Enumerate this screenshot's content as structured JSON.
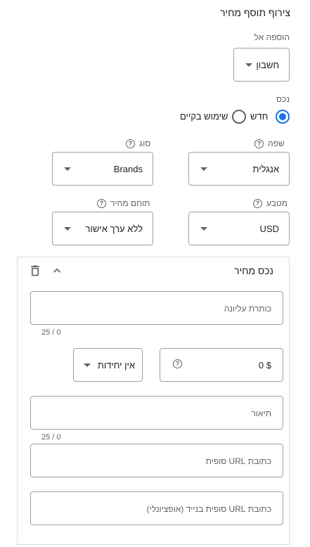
{
  "title": "צירוף תוסף מחיר",
  "add_to": {
    "label": "הוספה אל",
    "value": "חשבון"
  },
  "asset": {
    "label": "נכס",
    "options": [
      {
        "label": "חדש",
        "selected": true
      },
      {
        "label": "שימוש בקיים",
        "selected": false
      }
    ]
  },
  "language": {
    "label": "שפה",
    "value": "אנגלית"
  },
  "type": {
    "label": "סוג",
    "value": "Brands"
  },
  "currency": {
    "label": "מטבע",
    "value": "USD"
  },
  "price_range": {
    "label": "תוחם מחיר",
    "value": "ללא ערך אישור"
  },
  "price_asset": {
    "heading": "נכס מחיר",
    "header_field": {
      "placeholder": "כותרת עליונה",
      "counter": "25 / 0"
    },
    "price_field": {
      "value": "0 $"
    },
    "unit_select": {
      "value": "אין יחידות"
    },
    "description_field": {
      "placeholder": "תיאור",
      "counter": "25 / 0"
    },
    "final_url_field": {
      "placeholder": "כתובת URL סופית"
    },
    "mobile_url_field": {
      "placeholder": "כתובת URL סופית בנייד (אופציונלי)"
    }
  },
  "icons": {
    "help": "help-circle-icon",
    "delete": "trash-icon",
    "collapse": "chevron-up-icon",
    "dropdown": "caret-down-icon"
  },
  "colors": {
    "accent": "#1a73e8",
    "text": "#202124",
    "secondary": "#5f6368",
    "border": "#9aa0a6"
  }
}
